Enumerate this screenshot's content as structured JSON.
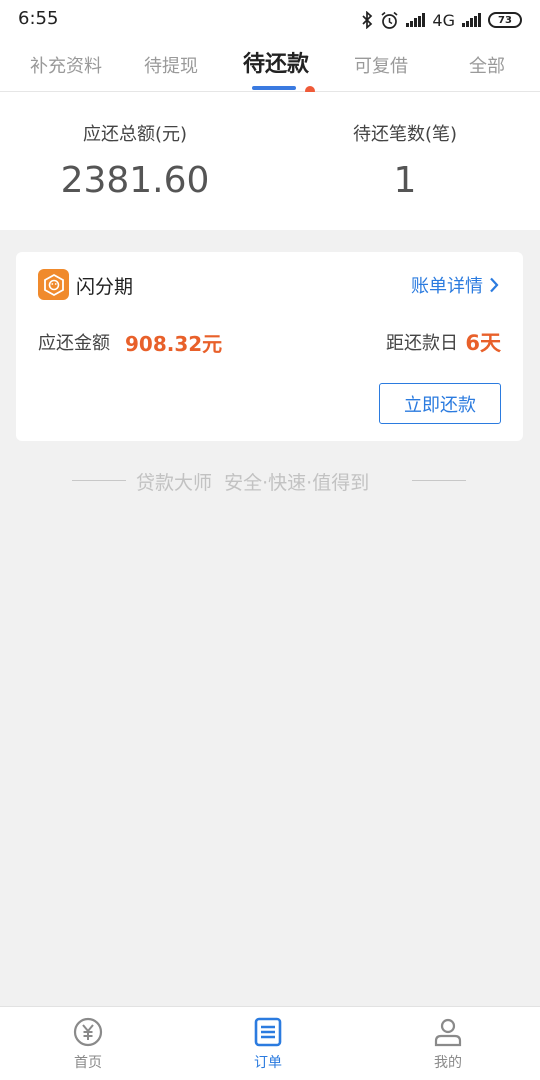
{
  "status": {
    "time": "6:55",
    "network": "4G",
    "battery": "73",
    "icons": [
      "bluetooth-icon",
      "alarm-icon",
      "signal-icon",
      "signal-icon",
      "battery-icon"
    ]
  },
  "tabs": [
    {
      "label": "补充资料",
      "active": false
    },
    {
      "label": "待提现",
      "active": false
    },
    {
      "label": "待还款",
      "active": true,
      "badge": "dot"
    },
    {
      "label": "可复借",
      "active": false
    },
    {
      "label": "全部",
      "active": false
    }
  ],
  "summary": {
    "total_label": "应还总额(元)",
    "total_value": "2381.60",
    "count_label": "待还笔数(笔)",
    "count_value": "1"
  },
  "order_card": {
    "product_icon": "lion-logo-icon",
    "product_name": "闪分期",
    "detail_link": "账单详情",
    "amount_label": "应还金额",
    "amount_value": "908.32元",
    "due_label": "距还款日",
    "due_value": "6天",
    "repay_button": "立即还款"
  },
  "slogan": {
    "brand": "贷款大师",
    "tagline": "安全·快速·值得到"
  },
  "bottom_nav": [
    {
      "label": "首页",
      "icon": "yuan-icon",
      "active": false
    },
    {
      "label": "订单",
      "icon": "order-list-icon",
      "active": true
    },
    {
      "label": "我的",
      "icon": "user-icon",
      "active": false
    }
  ],
  "colors": {
    "accent": "#2b7bdf",
    "highlight": "#e8602a",
    "badge": "#ef5a38",
    "background": "#f1f1f1"
  }
}
